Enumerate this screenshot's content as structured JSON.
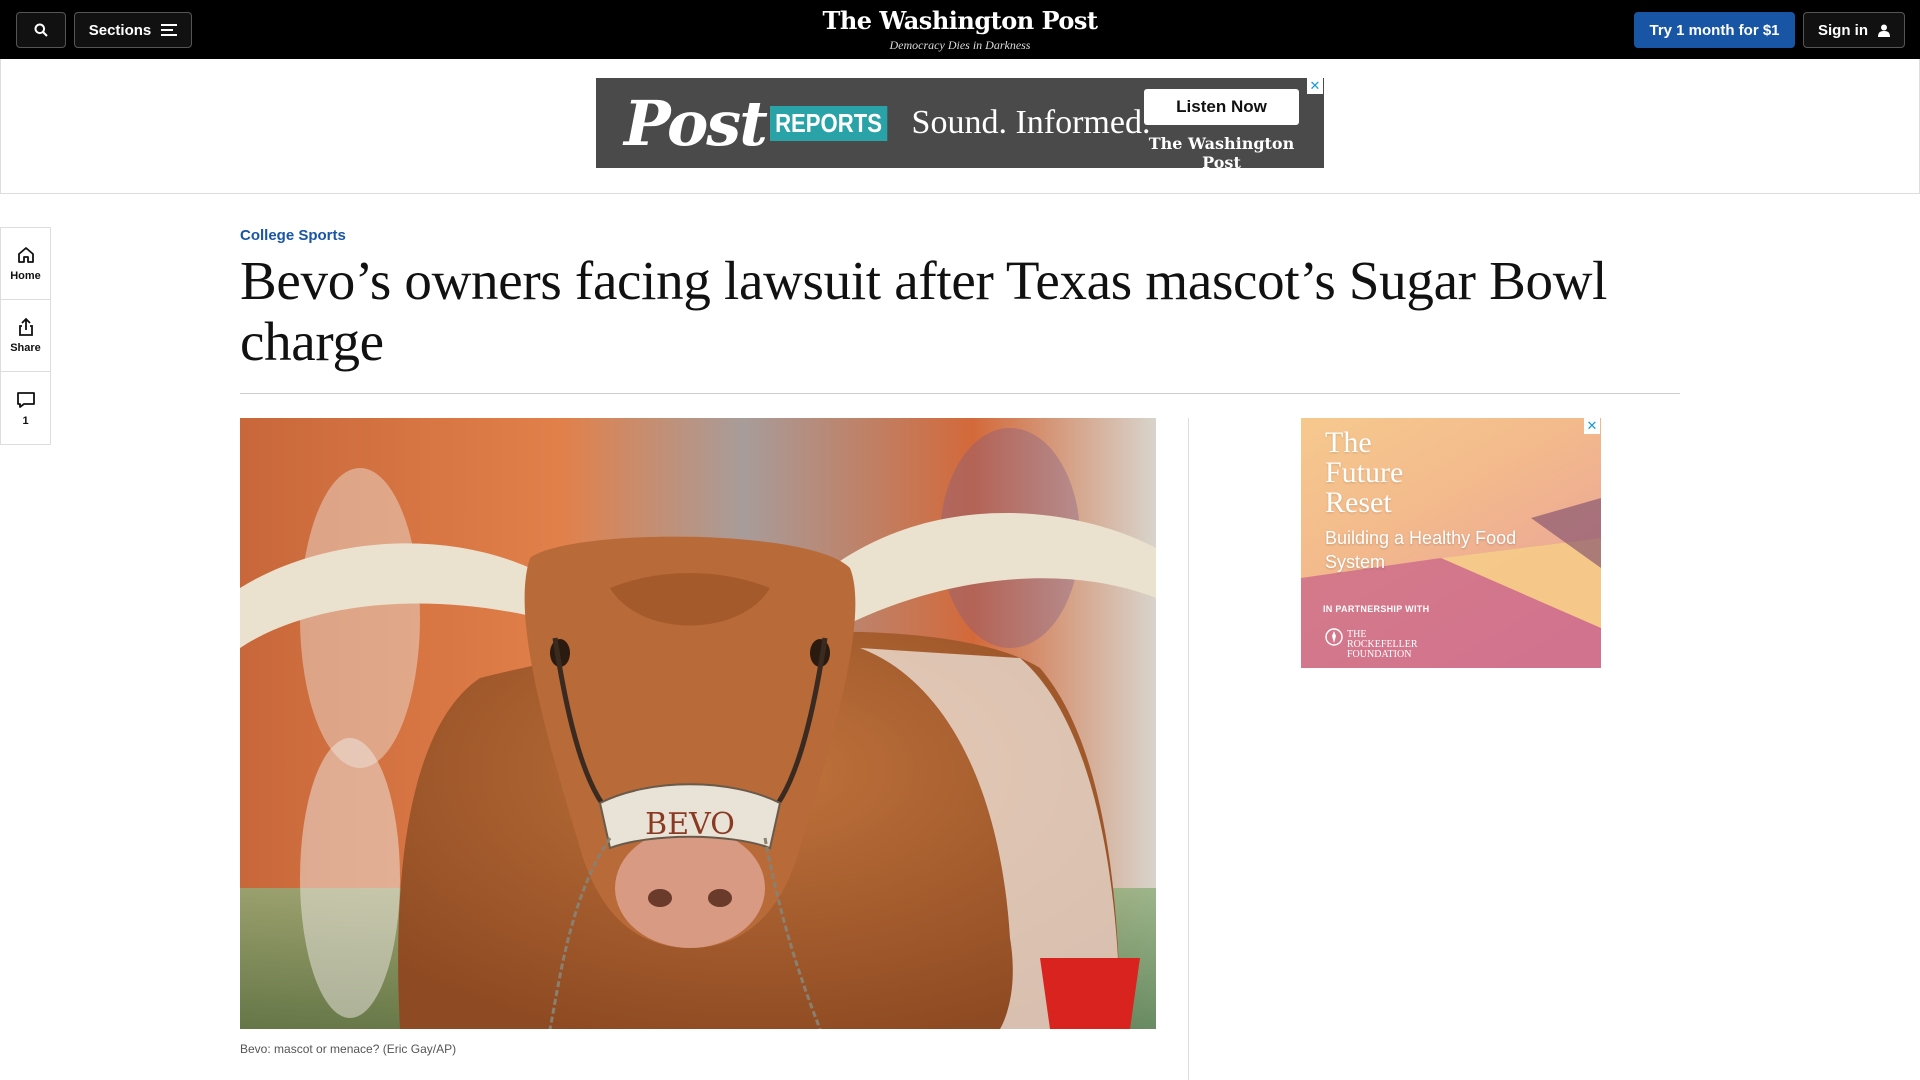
{
  "header": {
    "sections_label": "Sections",
    "logo": "The Washington Post",
    "tagline": "Democracy Dies in Darkness",
    "subscribe_label": "Try 1 month for $1",
    "signin_label": "Sign in"
  },
  "top_ad": {
    "brand": "Post",
    "product": "REPORTS",
    "slogan": "Sound. Informed.",
    "cta": "Listen Now",
    "publisher": "The Washington Post"
  },
  "rail": {
    "home": "Home",
    "share": "Share",
    "comments_count": "1"
  },
  "article": {
    "kicker": "College Sports",
    "headline": "Bevo’s owners facing lawsuit after Texas mascot’s Sugar Bowl charge",
    "photo_halter_text": "BEVO",
    "caption": "Bevo: mascot or menace? (Eric Gay/AP)"
  },
  "side_ad": {
    "title": "The Future Reset",
    "subtitle": "Building a Healthy Food System",
    "partner_label": "IN PARTNERSHIP WITH",
    "partner_name": "THE ROCKEFELLER FOUNDATION"
  },
  "colors": {
    "accent": "#1955a5",
    "topbar": "#000000"
  }
}
